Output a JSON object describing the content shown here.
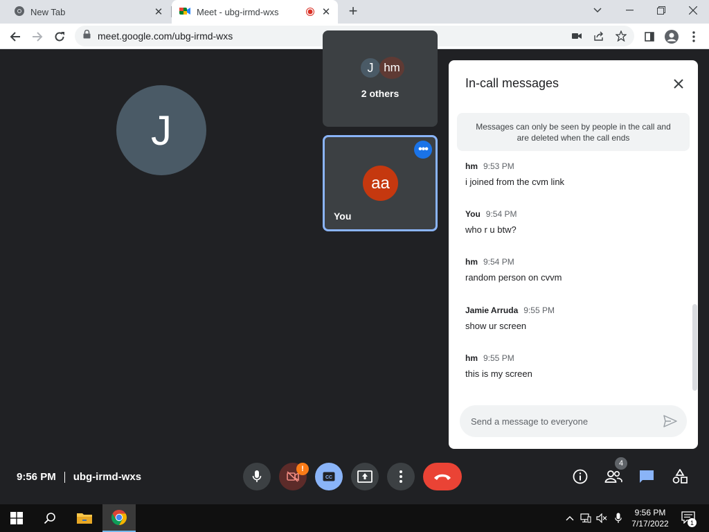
{
  "browser": {
    "tabs": [
      {
        "title": "New Tab",
        "icon": "chrome-icon"
      },
      {
        "title": "Meet - ubg-irmd-wxs",
        "icon": "meet-icon",
        "recording": true
      }
    ],
    "url": "meet.google.com/ubg-irmd-wxs"
  },
  "stage": {
    "main_initial": "J",
    "others_initials": [
      "J",
      "hm"
    ],
    "others_label": "2 others",
    "self_initials": "aa",
    "self_label": "You"
  },
  "chat": {
    "title": "In-call messages",
    "notice": "Messages can only be seen by people in the call and are deleted when the call ends",
    "messages": [
      {
        "sender": "hm",
        "time": "9:53 PM",
        "text": "i joined from the cvm link"
      },
      {
        "sender": "You",
        "time": "9:54 PM",
        "text": "who r u btw?"
      },
      {
        "sender": "hm",
        "time": "9:54 PM",
        "text": "random person on cvvm"
      },
      {
        "sender": "Jamie Arruda",
        "time": "9:55 PM",
        "text": "show ur screen"
      },
      {
        "sender": "hm",
        "time": "9:55 PM",
        "text": "this is my screen"
      }
    ],
    "input_placeholder": "Send a message to everyone"
  },
  "bottom_bar": {
    "time": "9:56 PM",
    "meeting_code": "ubg-irmd-wxs",
    "camera_warning": "!",
    "people_count": "4"
  },
  "taskbar": {
    "time": "9:56 PM",
    "date": "7/17/2022",
    "notification_count": "1"
  },
  "colors": {
    "stage_bg": "#202124",
    "end_call": "#ea4335",
    "active_blue": "#8ab4f8",
    "self_avatar": "#c5380f"
  }
}
